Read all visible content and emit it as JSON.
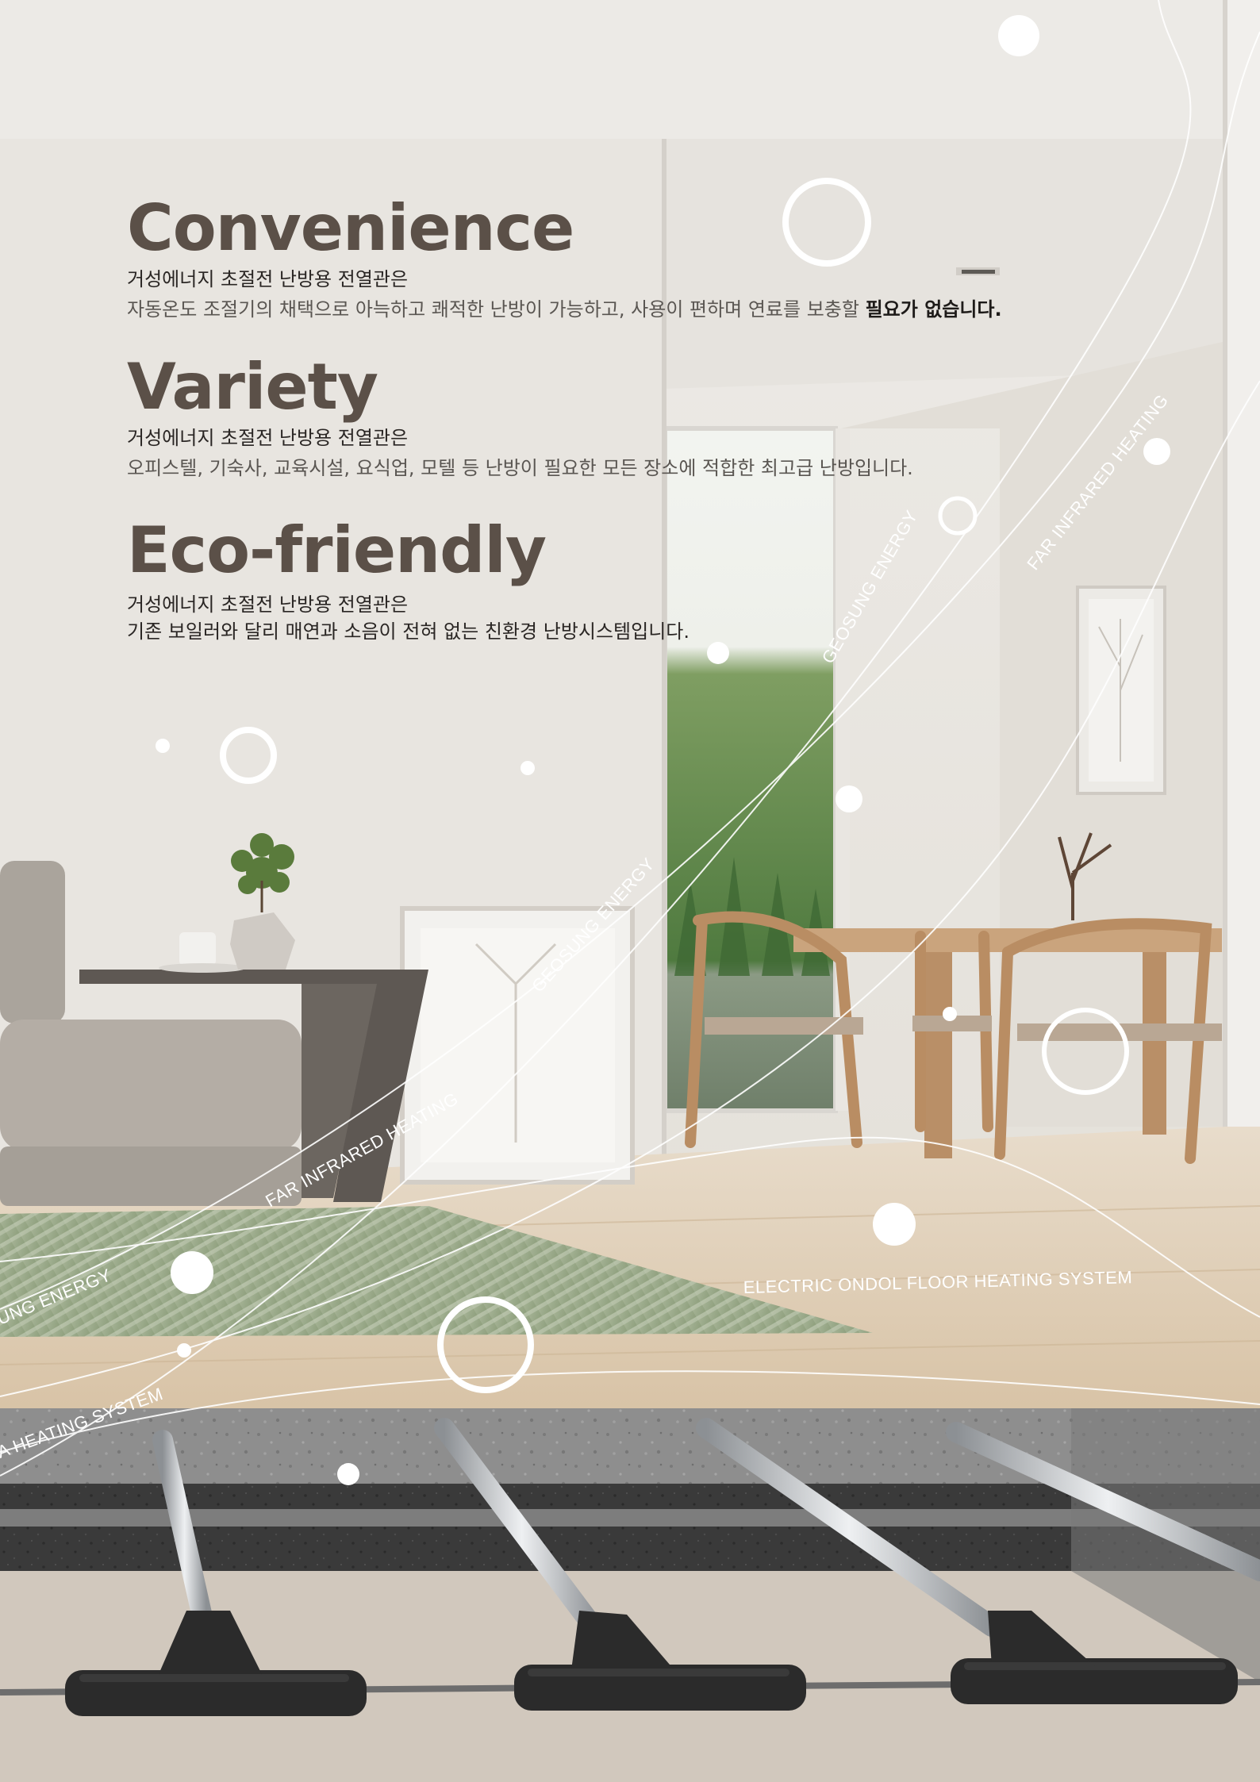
{
  "sections": [
    {
      "title": "Convenience",
      "lead": "거성에너지 초절전 난방용 전열관은",
      "body": "자동온도 조절기의 채택으로 아늑하고 쾌적한 난방이 가능하고, 사용이 편하며 연료를 보충할 ",
      "body_emphasis": "필요가 없습니다."
    },
    {
      "title": "Variety",
      "lead": "거성에너지 초절전 난방용 전열관은",
      "body": "오피스텔, 기숙사, 교육시설, 요식업, 모텔 등 난방이 필요한 모든 장소에 적합한 최고급 난방입니다."
    },
    {
      "title": "Eco-friendly",
      "lead": "거성에너지 초절전 난방용 전열관은",
      "body": "기존 보일러와 달리 매연과 소음이 전혀 없는 친환경 난방시스템입니다."
    }
  ],
  "wave_labels": {
    "far_infrared_upper": "FAR INFRARED HEATING",
    "geosung_upper": "GEOSUNG ENERGY",
    "geosung_mid": "GEOSUNG ENERGY",
    "far_infrared_mid": "FAR INFRARED HEATING",
    "geosung_left": "UNG ENERGY",
    "ondol": "ELECTRIC ONDOL FLOOR HEATING SYSTEM",
    "heating_left": "A HEATING SYSTEM"
  },
  "colors": {
    "headline": "#5b5048",
    "text": "#2a2624",
    "wall": "#e9e6e1",
    "floor": "#dcc8ad",
    "rug": "#9aab8a",
    "pipe": "#bfc3c6",
    "connector": "#2b2b2b",
    "trees": "#5f8a4a"
  }
}
